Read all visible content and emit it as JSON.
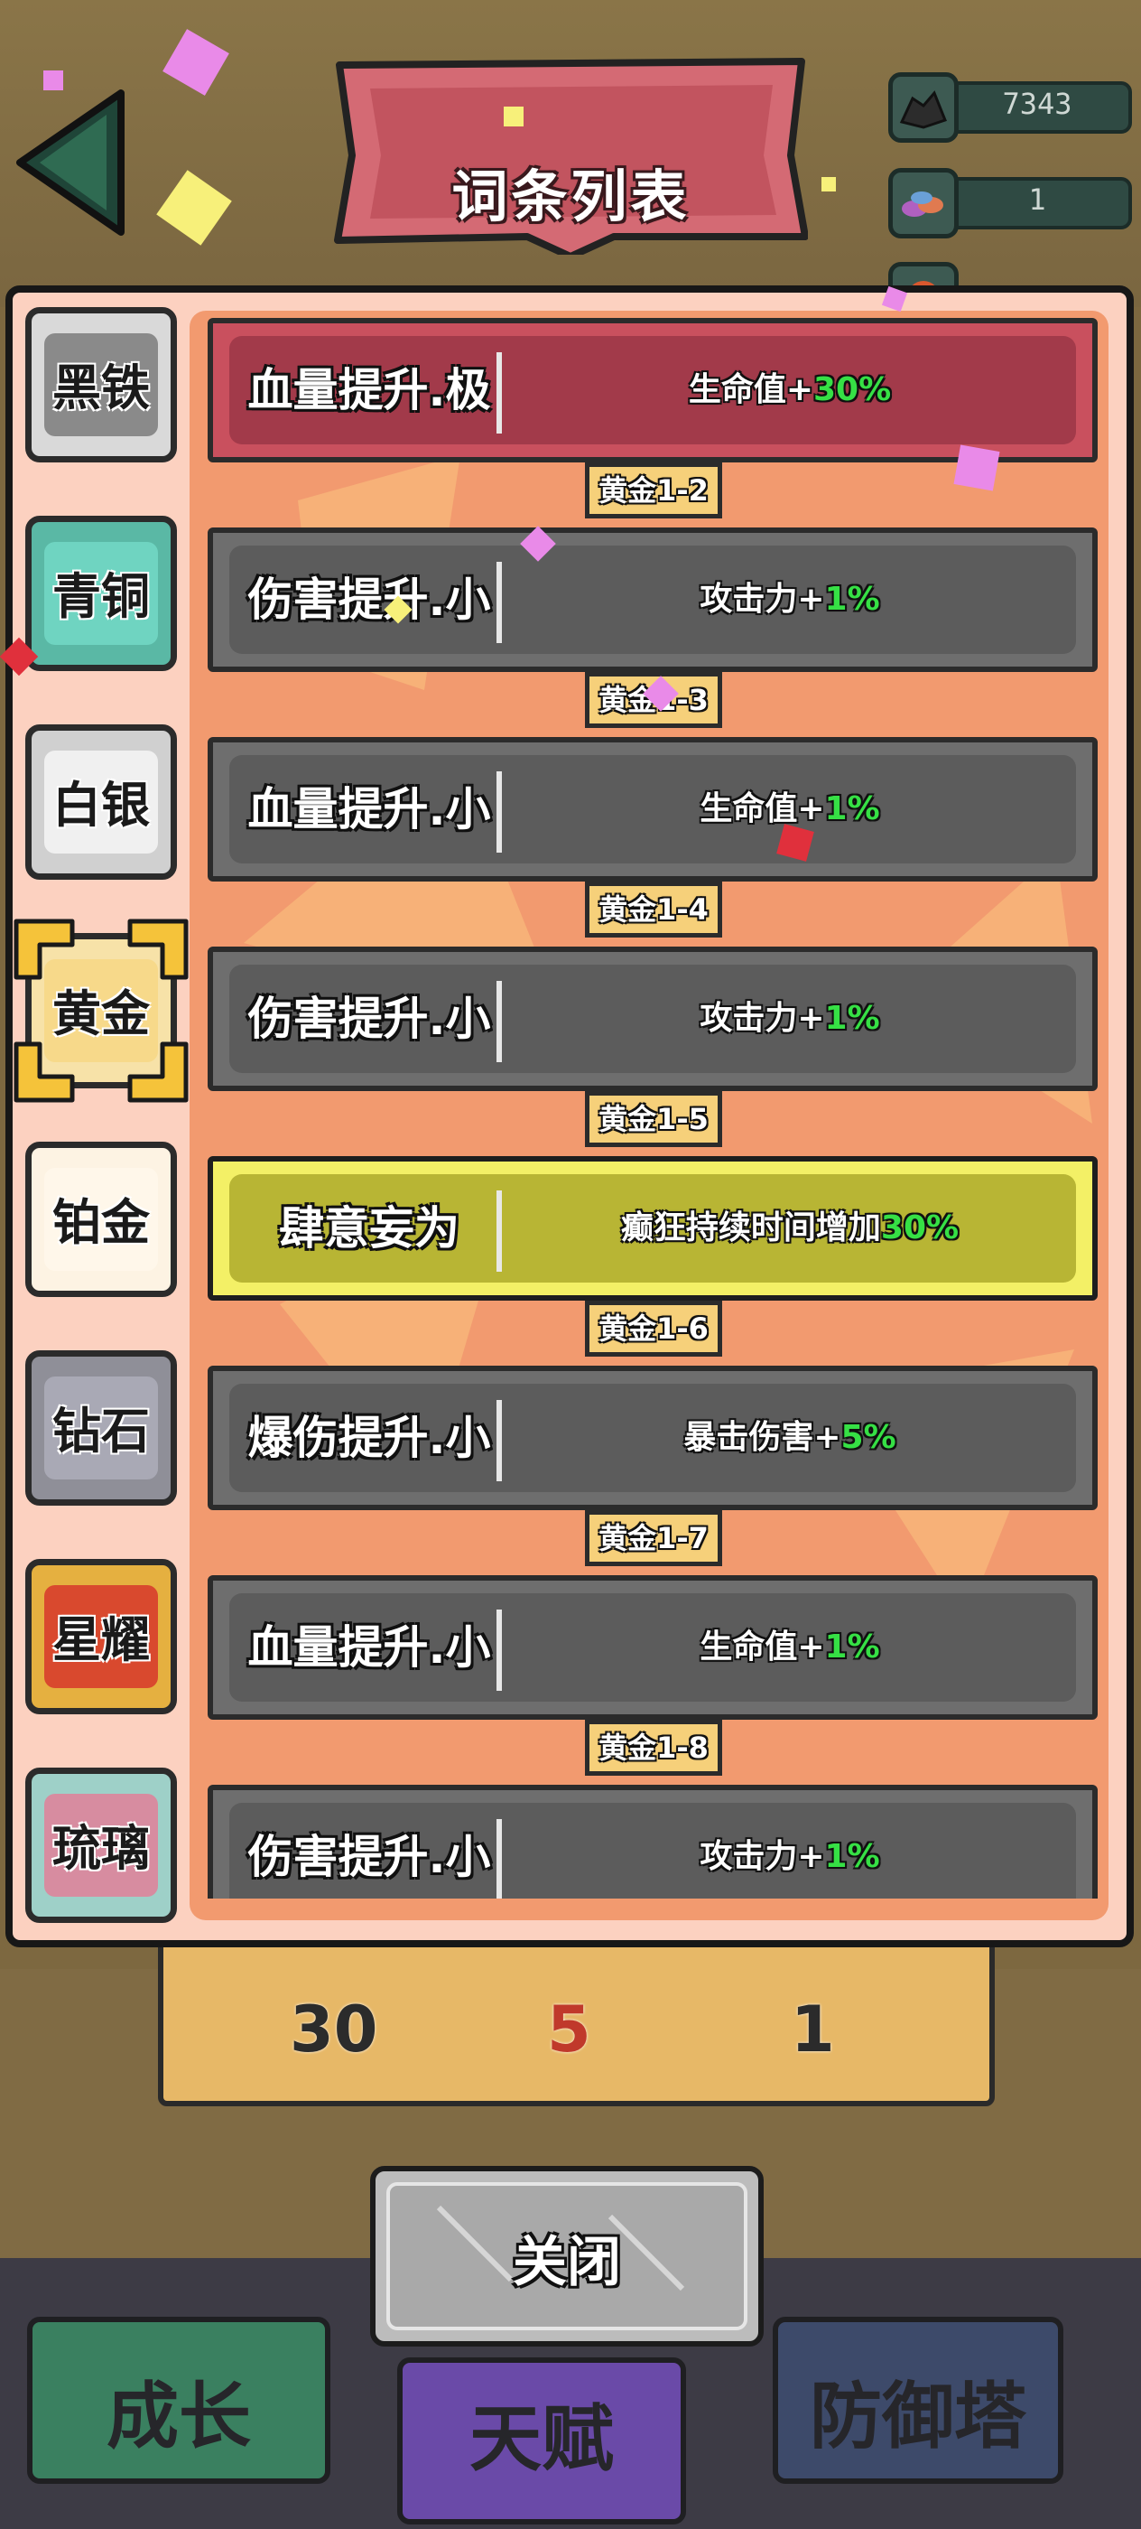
{
  "header": {
    "title": "词条列表",
    "resources": [
      {
        "icon": "coal-ore-icon",
        "value": "7343"
      },
      {
        "icon": "gem-pile-icon",
        "value": "1"
      },
      {
        "icon": "red-crystal-icon",
        "value": ""
      }
    ]
  },
  "tiers": [
    {
      "label": "黑铁",
      "color": "#8a8a8a"
    },
    {
      "label": "青铜",
      "color": "#6fd4c1"
    },
    {
      "label": "白银",
      "color": "#f0f0f0"
    },
    {
      "label": "黄金",
      "color": "#f7d98a",
      "selected": true
    },
    {
      "label": "铂金",
      "color": "#fdf3e3"
    },
    {
      "label": "钻石",
      "color": "#a9a9b5"
    },
    {
      "label": "星耀",
      "color": "#d9492e"
    },
    {
      "label": "琉璃",
      "color": "#d78ca0"
    }
  ],
  "affixes": [
    {
      "name": "血量提升.极",
      "effect_text": "生命值+",
      "effect_value": "30%",
      "style": "red"
    },
    {
      "level": "黄金1-2",
      "name": "伤害提升.小",
      "effect_text": "攻击力+",
      "effect_value": "1%",
      "style": "gray"
    },
    {
      "level": "黄金1-3",
      "name": "血量提升.小",
      "effect_text": "生命值+",
      "effect_value": "1%",
      "style": "gray"
    },
    {
      "level": "黄金1-4",
      "name": "伤害提升.小",
      "effect_text": "攻击力+",
      "effect_value": "1%",
      "style": "gray"
    },
    {
      "level": "黄金1-5",
      "name": "肆意妄为",
      "effect_text": "癫狂持续时间增加",
      "effect_value": "30%",
      "style": "yellow"
    },
    {
      "level": "黄金1-6",
      "name": "爆伤提升.小",
      "effect_text": "暴击伤害+",
      "effect_value": "5%",
      "style": "gray"
    },
    {
      "level": "黄金1-7",
      "name": "血量提升.小",
      "effect_text": "生命值+",
      "effect_value": "1%",
      "style": "gray"
    },
    {
      "level": "黄金1-8",
      "name": "伤害提升.小",
      "effect_text": "攻击力+",
      "effect_value": "1%",
      "style": "gray"
    }
  ],
  "rewards": [
    "30",
    "5",
    "1"
  ],
  "close_label": "关闭",
  "nav": [
    {
      "label": "成长",
      "color": "#3a8060"
    },
    {
      "label": "天赋",
      "color": "#6a4aa8"
    },
    {
      "label": "防御塔",
      "color": "#3d4a6a"
    }
  ],
  "colors": {
    "row_red": "#a23a4a",
    "row_gray": "#5c5c5c",
    "row_yellow": "#b8b534",
    "highlight_green": "#36e045"
  }
}
